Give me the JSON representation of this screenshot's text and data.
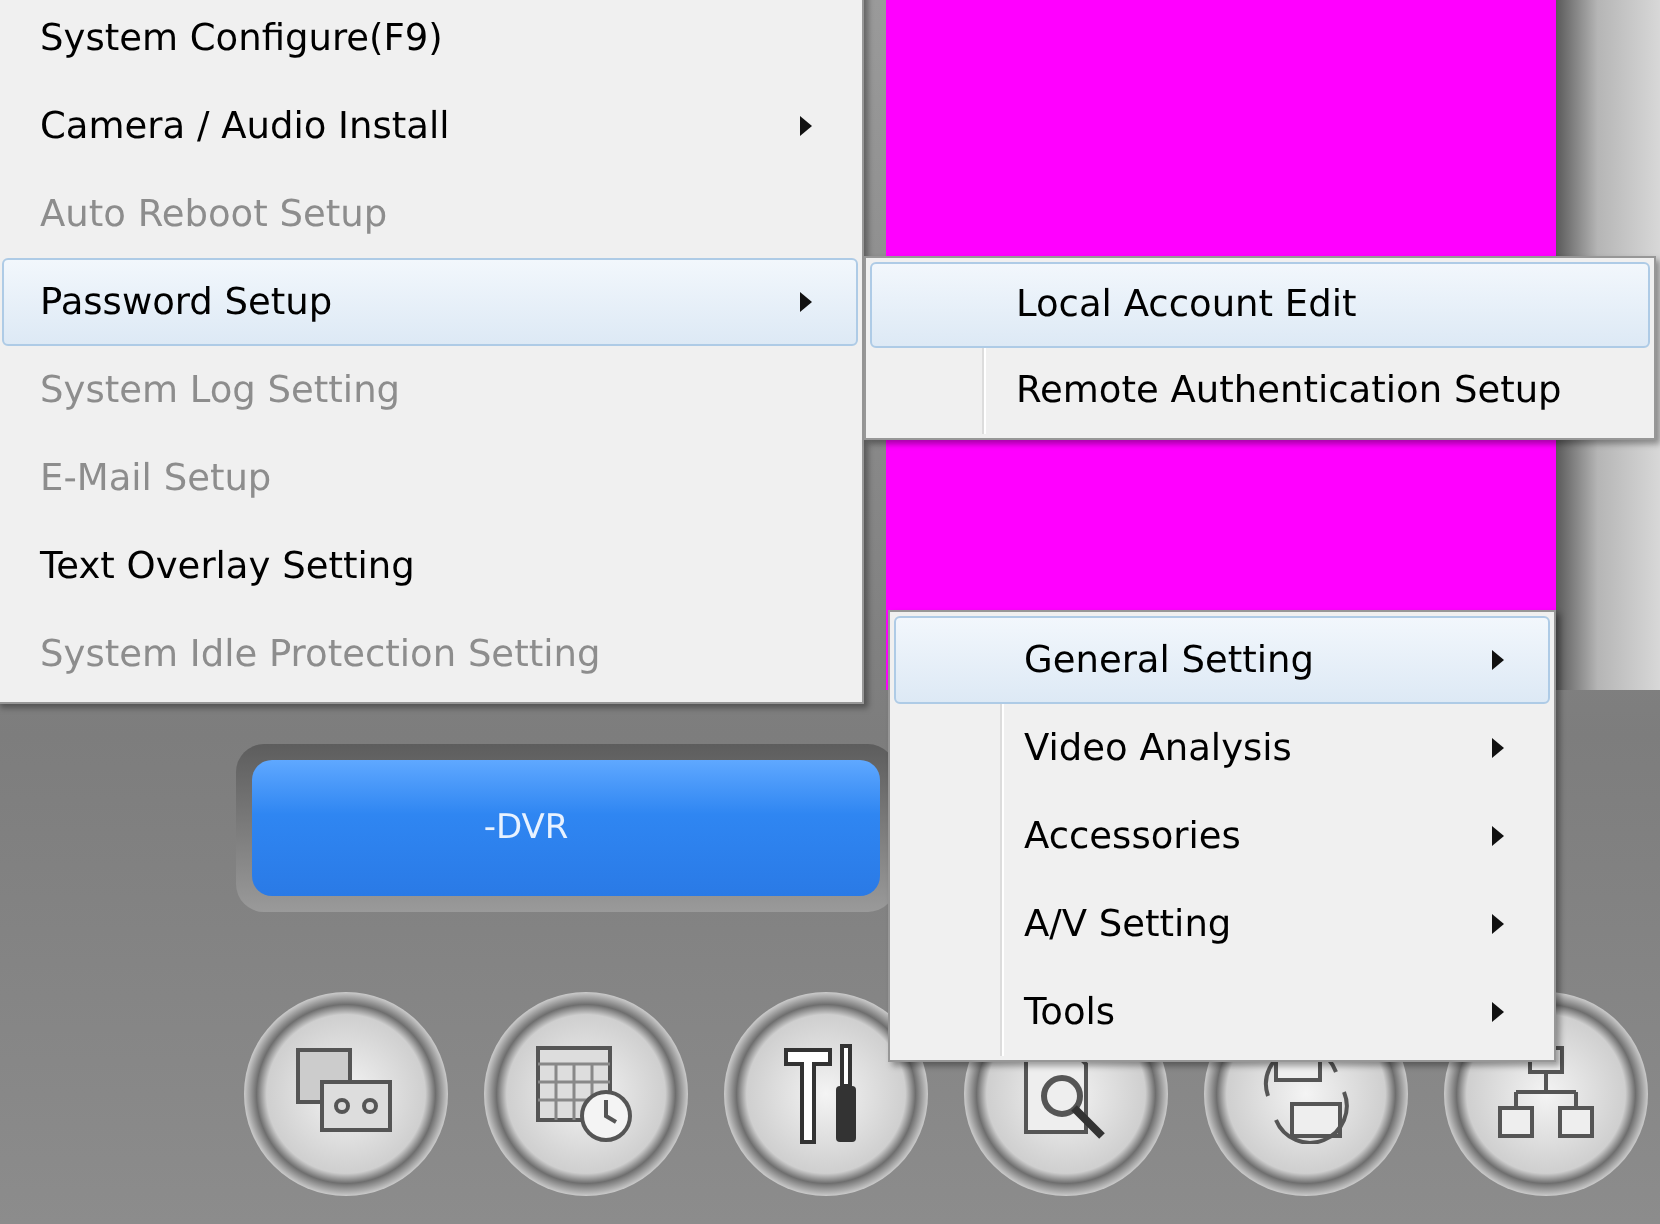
{
  "main_menu": {
    "items": [
      {
        "label": "System Configure(F9)",
        "disabled": false,
        "has_submenu": false,
        "selected": false
      },
      {
        "label": "Camera / Audio Install",
        "disabled": false,
        "has_submenu": true,
        "selected": false
      },
      {
        "label": "Auto Reboot Setup",
        "disabled": true,
        "has_submenu": false,
        "selected": false
      },
      {
        "label": "Password Setup",
        "disabled": false,
        "has_submenu": true,
        "selected": true
      },
      {
        "label": "System Log Setting",
        "disabled": true,
        "has_submenu": false,
        "selected": false
      },
      {
        "label": "E-Mail Setup",
        "disabled": true,
        "has_submenu": false,
        "selected": false
      },
      {
        "label": "Text Overlay Setting",
        "disabled": false,
        "has_submenu": false,
        "selected": false
      },
      {
        "label": "System Idle Protection Setting",
        "disabled": true,
        "has_submenu": false,
        "selected": false
      }
    ]
  },
  "password_submenu": {
    "items": [
      {
        "label": "Local Account Edit",
        "selected": true
      },
      {
        "label": "Remote Authentication Setup",
        "selected": false
      }
    ]
  },
  "settings_menu": {
    "items": [
      {
        "label": "General Setting",
        "has_submenu": true,
        "selected": true
      },
      {
        "label": "Video Analysis",
        "has_submenu": true,
        "selected": false
      },
      {
        "label": "Accessories",
        "has_submenu": true,
        "selected": false
      },
      {
        "label": "A/V Setting",
        "has_submenu": true,
        "selected": false
      },
      {
        "label": "Tools",
        "has_submenu": true,
        "selected": false
      }
    ]
  },
  "display": {
    "text": "-DVR"
  },
  "toolbar": {
    "buttons": [
      {
        "kind": "tape"
      },
      {
        "kind": "schedule"
      },
      {
        "kind": "tools"
      },
      {
        "kind": "search"
      },
      {
        "kind": "backup"
      },
      {
        "kind": "network"
      }
    ]
  }
}
